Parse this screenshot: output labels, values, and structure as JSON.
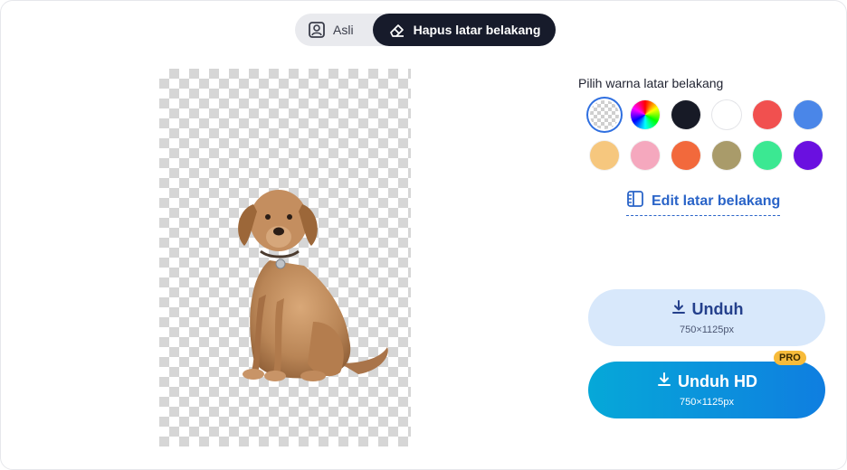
{
  "toggle": {
    "original_label": "Asli",
    "remove_bg_label": "Hapus latar belakang",
    "active": "remove_bg"
  },
  "preview": {
    "image": "dog-cutout-on-transparent",
    "background": "transparent-checkerboard"
  },
  "color_picker": {
    "title": "Pilih warna latar belakang",
    "selected": "transparent",
    "row1": [
      "transparent",
      "rainbow",
      "#171a26",
      "#ffffff",
      "#f1504f",
      "#4a86e8"
    ],
    "row2": [
      "#f6c77e",
      "#f5a8be",
      "#f2693c",
      "#a99b6a",
      "#3be892",
      "#6a10e0"
    ]
  },
  "edit_background": {
    "label": "Edit latar belakang",
    "icon": "edit-background-icon"
  },
  "download": {
    "label": "Unduh",
    "dimensions": "750×1125px",
    "icon": "download-icon"
  },
  "download_hd": {
    "label": "Unduh HD",
    "dimensions": "750×1125px",
    "badge": "PRO",
    "icon": "download-icon"
  },
  "colors": {
    "accent": "#2f6fe0",
    "toggle_active_bg": "#171b2b",
    "download_bg": "#d8e8fb",
    "download_hd_gradient": [
      "#06a8d8",
      "#0f7ee0"
    ],
    "pro_badge": "#f7bb3a"
  }
}
